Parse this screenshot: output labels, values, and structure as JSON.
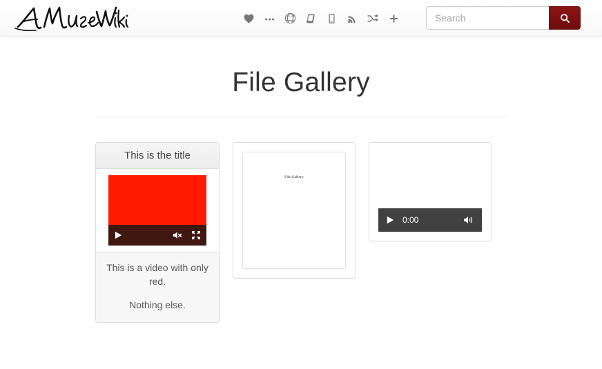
{
  "navbar": {
    "brand_text": "A MuseWiki",
    "brand_icon": "signature-wordmark",
    "icons": [
      {
        "name": "heart-icon",
        "label": "Favorites"
      },
      {
        "name": "ellipsis-icon",
        "label": "More"
      },
      {
        "name": "globe-icon",
        "label": "Language"
      },
      {
        "name": "book-icon",
        "label": "Book"
      },
      {
        "name": "tablet-icon",
        "label": "Mobile"
      },
      {
        "name": "rss-icon",
        "label": "Feed"
      },
      {
        "name": "random-icon",
        "label": "Random"
      },
      {
        "name": "plus-icon",
        "label": "Add"
      }
    ],
    "search": {
      "placeholder": "Search",
      "value": "",
      "button_icon": "search-icon",
      "button_color": "#7d1010"
    }
  },
  "main": {
    "page_title": "File Gallery",
    "cards": [
      {
        "type": "video",
        "heading": "This is the title",
        "media_color": "#ff1a00",
        "controls_color": "#40180f",
        "controls": [
          {
            "name": "play-button",
            "icon": "play-icon"
          },
          {
            "name": "mute-button",
            "icon": "volume-muted-icon"
          },
          {
            "name": "fullscreen-button",
            "icon": "fullscreen-icon"
          }
        ],
        "caption_lines": [
          "This is a video with only red.",
          "Nothing else."
        ]
      },
      {
        "type": "pdf-thumbnail",
        "page_title": "File Gallery"
      },
      {
        "type": "audio",
        "bar_color": "#414141",
        "time": "0:00",
        "controls": [
          {
            "name": "play-button",
            "icon": "play-icon"
          },
          {
            "name": "volume-button",
            "icon": "volume-icon"
          }
        ]
      }
    ]
  }
}
